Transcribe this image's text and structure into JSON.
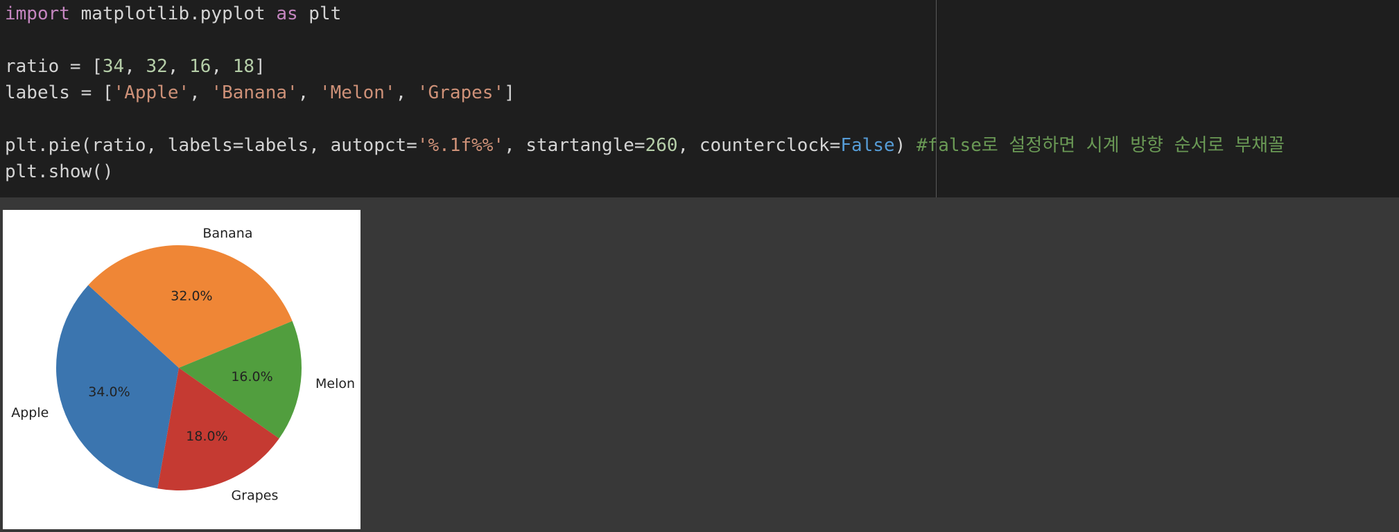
{
  "code": {
    "line1": {
      "kw_import": "import",
      "module": " matplotlib.pyplot ",
      "kw_as": "as",
      "alias": " plt"
    },
    "line2": {
      "prefix": "ratio = [",
      "n1": "34",
      "c1": ", ",
      "n2": "32",
      "c2": ", ",
      "n3": "16",
      "c3": ", ",
      "n4": "18",
      "suffix": "]"
    },
    "line3": {
      "prefix": "labels = [",
      "s1": "'Apple'",
      "c1": ", ",
      "s2": "'Banana'",
      "c2": ", ",
      "s3": "'Melon'",
      "c3": ", ",
      "s4": "'Grapes'",
      "suffix": "]"
    },
    "line4": {
      "prefix": "plt.pie(ratio, labels=labels, autopct=",
      "fmt": "'%.1f%%'",
      "mid1": ", startangle=",
      "angle": "260",
      "mid2": ", counterclock=",
      "flag": "False",
      "close": ") ",
      "comment": "#false로 설정하면 시계 방향 순서로 부채꼴"
    },
    "line5": "plt.show()"
  },
  "chart_data": {
    "type": "pie",
    "categories": [
      "Apple",
      "Banana",
      "Melon",
      "Grapes"
    ],
    "values": [
      34,
      32,
      16,
      18
    ],
    "percent_labels": [
      "34.0%",
      "32.0%",
      "16.0%",
      "18.0%"
    ],
    "colors": [
      "#3b75af",
      "#ef8636",
      "#519e3e",
      "#c53a32"
    ],
    "startangle": 260,
    "counterclock": false
  }
}
